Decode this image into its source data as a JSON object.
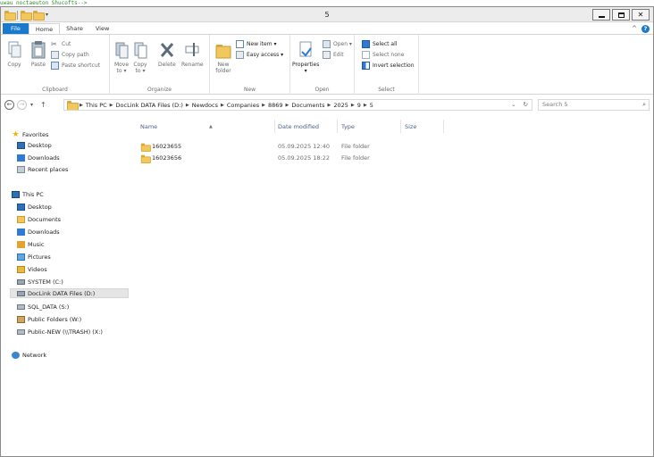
{
  "background_text": "uwau noctaeuton Shucofts-->",
  "window": {
    "title": "5"
  },
  "ribbon_tabs": [
    "File",
    "Home",
    "Share",
    "View"
  ],
  "ribbon": {
    "clipboard": {
      "label": "Clipboard",
      "copy": "Copy",
      "paste": "Paste",
      "cut": "Cut",
      "copy_path": "Copy path",
      "paste_shortcut": "Paste shortcut"
    },
    "organize": {
      "label": "Organize",
      "move_to": "Move\nto ▾",
      "copy_to": "Copy\nto ▾",
      "delete": "Delete",
      "rename": "Rename"
    },
    "new": {
      "label": "New",
      "new_folder": "New\nfolder",
      "new_item": "New item ▾",
      "easy_access": "Easy access ▾"
    },
    "open": {
      "label": "Open",
      "properties": "Properties\n▾",
      "open": "Open ▾",
      "edit": "Edit"
    },
    "select": {
      "label": "Select",
      "select_all": "Select all",
      "select_none": "Select none",
      "invert_selection": "Invert selection"
    }
  },
  "address": {
    "crumbs": [
      "This PC",
      "DocLink DATA Files (D:)",
      "Newdocs",
      "Companies",
      "8869",
      "Documents",
      "2025",
      "9",
      "5"
    ],
    "search_placeholder": "Search 5"
  },
  "nav_pane": {
    "favorites_header": "Favorites",
    "favorites": [
      "Desktop",
      "Downloads",
      "Recent places"
    ],
    "this_pc_header": "This PC",
    "this_pc": [
      "Desktop",
      "Documents",
      "Downloads",
      "Music",
      "Pictures",
      "Videos",
      "SYSTEM (C:)",
      "DocLink DATA Files (D:)",
      "SQL_DATA (S:)",
      "Public Folders (W:)",
      "Public-NEW (\\\\TRASH) (X:)"
    ],
    "network": "Network"
  },
  "file_list": {
    "columns": [
      "Name",
      "Date modified",
      "Type",
      "Size"
    ],
    "rows": [
      {
        "name": "16023655",
        "date": "05.09.2025 12:40",
        "type": "File folder",
        "size": ""
      },
      {
        "name": "16023656",
        "date": "05.09.2025 18:22",
        "type": "File folder",
        "size": ""
      }
    ]
  },
  "colors": {
    "file_tab": "#1979ca",
    "folder": "#f2c75c",
    "column_header": "#4d6082"
  }
}
